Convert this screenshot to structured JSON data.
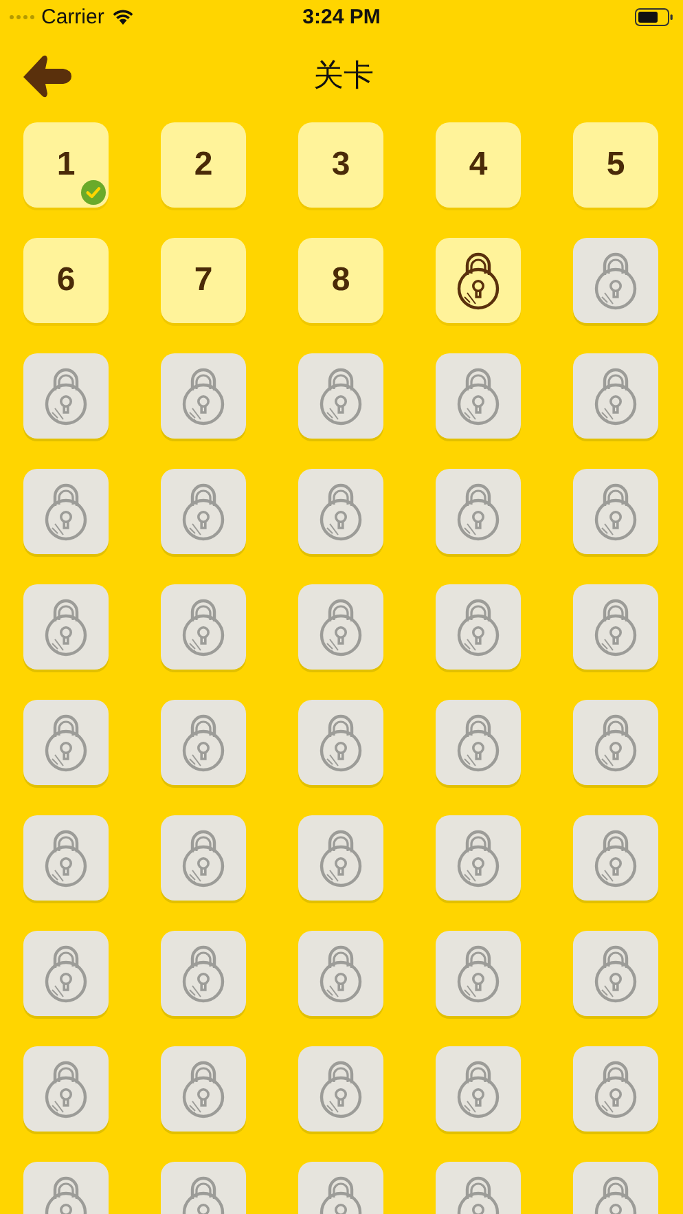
{
  "status_bar": {
    "carrier": "Carrier",
    "time": "3:24 PM"
  },
  "nav": {
    "title": "关卡"
  },
  "levels": [
    {
      "kind": "number",
      "label": "1",
      "completed": true
    },
    {
      "kind": "number",
      "label": "2",
      "completed": false
    },
    {
      "kind": "number",
      "label": "3",
      "completed": false
    },
    {
      "kind": "number",
      "label": "4",
      "completed": false
    },
    {
      "kind": "number",
      "label": "5",
      "completed": false
    },
    {
      "kind": "number",
      "label": "6",
      "completed": false
    },
    {
      "kind": "number",
      "label": "7",
      "completed": false
    },
    {
      "kind": "number",
      "label": "8",
      "completed": false
    },
    {
      "kind": "next_lock"
    },
    {
      "kind": "lock"
    },
    {
      "kind": "lock"
    },
    {
      "kind": "lock"
    },
    {
      "kind": "lock"
    },
    {
      "kind": "lock"
    },
    {
      "kind": "lock"
    },
    {
      "kind": "lock"
    },
    {
      "kind": "lock"
    },
    {
      "kind": "lock"
    },
    {
      "kind": "lock"
    },
    {
      "kind": "lock"
    },
    {
      "kind": "lock"
    },
    {
      "kind": "lock"
    },
    {
      "kind": "lock"
    },
    {
      "kind": "lock"
    },
    {
      "kind": "lock"
    },
    {
      "kind": "lock"
    },
    {
      "kind": "lock"
    },
    {
      "kind": "lock"
    },
    {
      "kind": "lock"
    },
    {
      "kind": "lock"
    },
    {
      "kind": "lock"
    },
    {
      "kind": "lock"
    },
    {
      "kind": "lock"
    },
    {
      "kind": "lock"
    },
    {
      "kind": "lock"
    },
    {
      "kind": "lock"
    },
    {
      "kind": "lock"
    },
    {
      "kind": "lock"
    },
    {
      "kind": "lock"
    },
    {
      "kind": "lock"
    },
    {
      "kind": "lock"
    },
    {
      "kind": "lock"
    },
    {
      "kind": "lock"
    },
    {
      "kind": "lock"
    },
    {
      "kind": "lock"
    },
    {
      "kind": "lock"
    },
    {
      "kind": "lock"
    },
    {
      "kind": "lock"
    },
    {
      "kind": "lock"
    },
    {
      "kind": "lock"
    }
  ]
}
